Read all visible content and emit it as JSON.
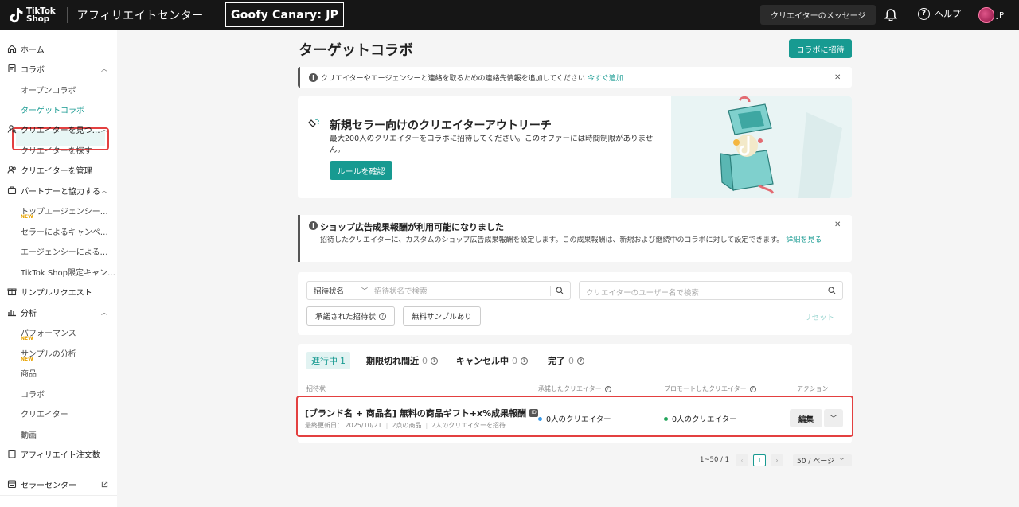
{
  "topbar": {
    "logo_line1": "TikTok",
    "logo_line2": "Shop",
    "title": "アフィリエイトセンター",
    "shop_name": "Goofy Canary: JP",
    "messages_label": "クリエイターのメッセージ",
    "help_label": "ヘルプ",
    "region": "JP"
  },
  "sidebar": {
    "home": "ホーム",
    "collab": "コラボ",
    "open_collab": "オープンコラボ",
    "target_collab": "ターゲットコラボ",
    "find_creators": "クリエイターを見つ…",
    "search_creators": "クリエイターを探す",
    "manage_creators": "クリエイターを管理",
    "partner": "パートナーと協力する",
    "top_agency": "トップエージェンシー…",
    "new1": "NEW",
    "seller_campaign": "セラーによるキャンペ…",
    "agency_campaign": "エージェンシーによる…",
    "tiktok_campaign": "TikTok Shop限定キャン…",
    "sample_request": "サンプルリクエスト",
    "analytics": "分析",
    "performance": "パフォーマンス",
    "new2": "NEW",
    "sample_analytics": "サンプルの分析",
    "new3": "NEW",
    "products": "商品",
    "collabs": "コラボ",
    "creators": "クリエイター",
    "videos": "動画",
    "affiliate_orders": "アフィリエイト注文数",
    "seller_center": "セラーセンター"
  },
  "main": {
    "page_title": "ターゲットコラボ",
    "invite_button": "コラボに招待",
    "contact_notice": {
      "text": "クリエイターやエージェンシーと連絡を取るための連絡先情報を追加してください",
      "link": "今すぐ追加"
    },
    "outreach": {
      "title": "新規セラー向けのクリエイターアウトリーチ",
      "desc": "最大200人のクリエイターをコラボに招待してください。このオファーには時間制限がありません。",
      "button": "ルールを確認"
    },
    "ads_notice": {
      "title": "ショップ広告成果報酬が利用可能になりました",
      "desc": "招待したクリエイターに、カスタムのショップ広告成果報酬を設定します。この成果報酬は、新規および継続中のコラボに対して設定できます。",
      "link": "詳細を見る"
    },
    "filters": {
      "select_label": "招待状名",
      "search_placeholder": "招待状名で検索",
      "creator_placeholder": "クリエイターのユーザー名で検索",
      "chip_accepted": "承諾された招待状",
      "chip_free_sample": "無料サンプルあり",
      "reset": "リセット"
    },
    "tabs": [
      {
        "label": "進行中",
        "count": "1"
      },
      {
        "label": "期限切れ間近",
        "count": "0"
      },
      {
        "label": "キャンセル中",
        "count": "0"
      },
      {
        "label": "完了",
        "count": "0"
      }
    ],
    "columns": {
      "invitation": "招待状",
      "accepted": "承諾したクリエイター",
      "promoted": "プロモートしたクリエイター",
      "actions": "アクション"
    },
    "row": {
      "title": "[ブランド名 + 商品名] 無料の商品ギフト+x%成果報酬",
      "id_tag": "ID",
      "updated": "最終更新日： 2025/10/21",
      "products": "2点の商品",
      "creators_invited": "2人のクリエイターを招待",
      "accepted_count": "0人のクリエイター",
      "promoted_count": "0人のクリエイター",
      "edit": "編集"
    },
    "pager": {
      "range": "1~50 / 1",
      "current": "1",
      "page_size": "50 / ページ"
    }
  },
  "colors": {
    "accent": "#179a91",
    "topbar": "#161616",
    "highlight_border": "#e34040",
    "accepted_dot": "#3b9ae8",
    "promoted_dot": "#22a55a"
  }
}
